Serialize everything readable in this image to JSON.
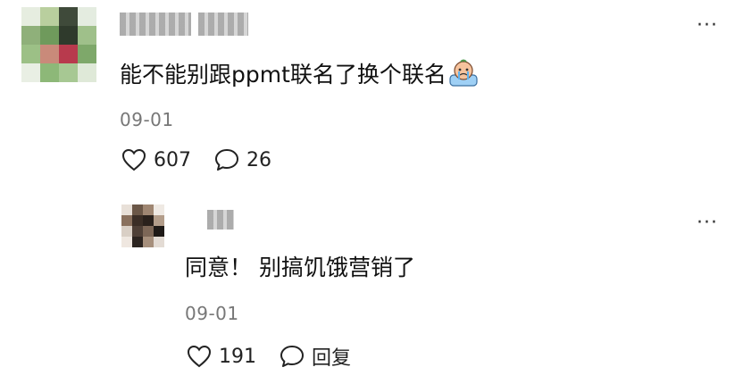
{
  "comments": [
    {
      "text": "能不能别跟ppmt联名了换个联名",
      "emoji": "crying-face-emoji",
      "date": "09-01",
      "likes": "607",
      "replies": "26",
      "more": "···"
    },
    {
      "text": "同意！ 别搞饥饿营销了",
      "date": "09-01",
      "likes": "191",
      "reply_label": "回复",
      "more": "···"
    }
  ],
  "colors": {
    "text": "#111111",
    "meta": "#777777"
  }
}
